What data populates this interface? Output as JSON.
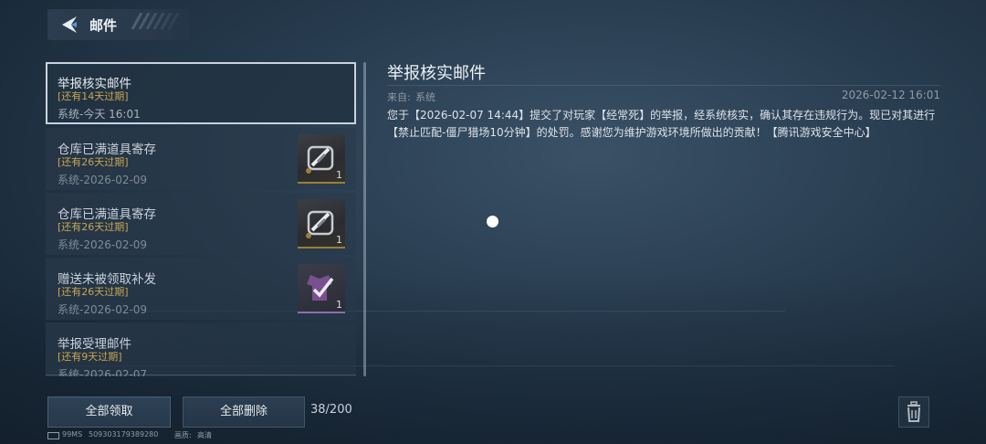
{
  "header": {
    "title": "邮件"
  },
  "mails": [
    {
      "subject": "举报核实邮件",
      "expire": "[还有14天过期]",
      "meta": "系统-今天 16:01",
      "selected": true,
      "attachment": null
    },
    {
      "subject": "仓库已满道具寄存",
      "expire": "[还有26天过期]",
      "meta": "系统-2026-02-09",
      "selected": false,
      "attachment": {
        "icon": "weapon-item-icon",
        "count": "1"
      }
    },
    {
      "subject": "仓库已满道具寄存",
      "expire": "[还有26天过期]",
      "meta": "系统-2026-02-09",
      "selected": false,
      "attachment": {
        "icon": "weapon-item-icon",
        "count": "1"
      }
    },
    {
      "subject": "赠送未被领取补发",
      "expire": "[还有26天过期]",
      "meta": "系统-2026-02-09",
      "selected": false,
      "attachment": {
        "icon": "outfit-item-icon",
        "count": "1"
      }
    },
    {
      "subject": "举报受理邮件",
      "expire": "[还有9天过期]",
      "meta": "系统-2026-02-07",
      "selected": false,
      "attachment": null
    }
  ],
  "detail": {
    "title": "举报核实邮件",
    "from_label": "来自:",
    "from_value": "系统",
    "date": "2026-02-12 16:01",
    "body_line1": "您于【2026-02-07 14:44】提交了对玩家【经常死】的举报，经系统核实，确认其存在违规行为。现已对其进行",
    "body_line2": "【禁止匹配-僵尸猎场10分钟】的处罚。感谢您为维护游戏环境所做出的贡献！【腾讯游戏安全中心】"
  },
  "footer": {
    "claim_all": "全部领取",
    "delete_all": "全部删除",
    "count": "38/200"
  },
  "status": {
    "ping": "99MS",
    "id": "509303179389280",
    "quality_label": "画质:",
    "quality": "高清"
  },
  "colors": {
    "accent_gold": "#c9a652",
    "selected_border": "#c8d3de"
  }
}
